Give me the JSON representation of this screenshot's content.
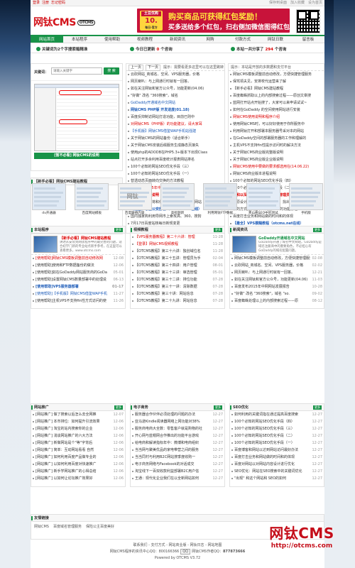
{
  "topbar": {
    "login": "登录",
    "register": "注册",
    "forgot": "忘记密码",
    "save_desktop": "保存到桌面",
    "favorites": "加入收藏",
    "home": "设为首页"
  },
  "header": {
    "logo": "网钛CMS",
    "logo_sub": "OTCMS",
    "banner": {
      "badge_top": "土豆优购",
      "badge_num": "10.",
      "badge_sub": "每日·官方",
      "line1": "购买商品可获得红包奖励！",
      "line2": "买多送给多个红包，扫右侧加微信图得红包·"
    }
  },
  "nav": [
    "网站首页",
    "本站程序",
    "使用帮助",
    "视频教程",
    "新闻资讯",
    "网购",
    "付款方式",
    "网钛日联",
    "留言板"
  ],
  "notice": {
    "a": "关键词为2个字搜索箱精准",
    "b": "今日已更新",
    "b_count": "0",
    "b_unit": "个咨询",
    "c": "本站一共分享了",
    "c_count": "294",
    "c_unit": "个咨询"
  },
  "kw": {
    "label": "关键词：",
    "placeholder": "请输入关键字",
    "button": "搜 索",
    "caption": "[暂不必看] 网钛CMS的说明"
  },
  "today": {
    "prev": "上一页",
    "next": "下一页",
    "tip": "提示：需要看更多这里可以在这里跳转",
    "items": [
      {
        "t": "云砍网站_商城名、空间、VPS服务器，价格",
        "c": ""
      },
      {
        "t": "网页喇叭：与上网通行时就有一回答。",
        "c": ""
      },
      {
        "t": "如在关注网钛和官方公众号，功能更新(04.06)",
        "c": ""
      },
      {
        "t": "\"好做\" 改名 \"360搜索\"，域名",
        "c": ""
      },
      {
        "t": "GoDaddy开通域名中文网站",
        "c": "blue"
      },
      {
        "t": "网钛CMS PHP版 开发进度(01.18)",
        "c": "bold-blue"
      },
      {
        "t": "百度反抑制访网站打造功能，目前已则中",
        "c": ""
      },
      {
        "t": "对网钛CMS（PHP版）的功能建议，请大家耳",
        "c": "red"
      },
      {
        "t": "【手机版】网钛CMS借鉴WAP手机站强建",
        "c": "blue"
      },
      {
        "t": "关于网钛CMS的网站备份（适合新手）",
        "c": ""
      },
      {
        "t": "关于网钛CMS安装后缀服务生成静态页接失",
        "c": ""
      },
      {
        "t": "使用php的ADODB在PHP5.3+版本下出现Class",
        "c": ""
      },
      {
        "t": "站点打开多余利用百度统计报表网站排名",
        "c": ""
      },
      {
        "t": "100个必知的网站SEO优化手段（三）",
        "c": ""
      },
      {
        "t": "100个必知的网站SEO优化手段（一）",
        "c": ""
      },
      {
        "t": "替透动态页面转向交换的方法教程",
        "c": ""
      },
      {
        "t": "百度发布2015年中网网站发展行报告",
        "c": "red"
      },
      {
        "t": "网站防后服务说明",
        "c": "bold-red"
      },
      {
        "t": "百度权价谷算将和你保留的对当地支持的网站",
        "c": ""
      },
      {
        "t": "【最全】哪些公安部营（otcms.net 在线）",
        "c": "bold-blue"
      },
      {
        "t": "国内独家购利用导网市上索攻高、360、搜狗",
        "c": ""
      },
      {
        "t": "7月17日百度站核每日新规变更",
        "c": ""
      },
      {
        "t": "【OTCMS教程】第三十六讲：独创的在线问",
        "c": "bold"
      }
    ]
  },
  "stat": {
    "tip": "提示：本站是开放的多数据和支付平台",
    "items": [
      {
        "t": "网钛CMS模板调整前自动修改，方便快捷管理服务",
        "c": ""
      },
      {
        "t": "保驾领夫见，安排校代运营来了解",
        "c": ""
      },
      {
        "t": "【新手必看】网钛CMS建站教程",
        "c": ""
      },
      {
        "t": "百度蜘蛛抓取以上的内部搜索过程——原创文章搜",
        "c": ""
      },
      {
        "t": "蓝网打开站点开始搜了，大家可以来申请试试~",
        "c": ""
      },
      {
        "t": "如何在GoDaddy 的空间使用网站进行安装",
        "c": ""
      },
      {
        "t": "网钛CMS使用说明和程序介绍",
        "c": "red"
      },
      {
        "t": "使用网钛CMS时，可以好好使用于你所服务中",
        "c": ""
      },
      {
        "t": "利用网钛打开和部署本服务器号采对本的网站",
        "c": ""
      },
      {
        "t": "在GoDaddy空间的部署服务器的工作和理解的",
        "c": ""
      },
      {
        "t": "主机VPS不支持fin性提示访问时的解决方法",
        "c": ""
      },
      {
        "t": "关于网钛CMS商业版完整版说明",
        "c": ""
      },
      {
        "t": "关于网钛CMS商业版企业版说明",
        "c": ""
      },
      {
        "t": "网钛CMS使用中要做的要求都选用在(14.06.22)",
        "c": "red"
      },
      {
        "t": "网钛CMS商业版本进程说明",
        "c": ""
      },
      {
        "t": "100个必知的网站SEO优化手段（四）",
        "c": ""
      },
      {
        "t": "100个必知的网站SEO优化手段（二）",
        "c": ""
      },
      {
        "t": "掉和以深究前前排名到获取你管理员提示",
        "c": "bold-red"
      },
      {
        "t": "从原设计拿到最后进行台运动，找出来的数据报",
        "c": ""
      },
      {
        "t": "新的方式提供选举 - 网钛CMS的功能原理",
        "c": ""
      },
      {
        "t": "百度打击业务和网站做的时间和的体现",
        "c": ""
      },
      {
        "t": "【最全】VPS模糊教程（otcms.net在线）",
        "c": "bold-blue"
      },
      {
        "t": "和使用的电子商务在站站中360搜索安装解释",
        "c": ""
      },
      {
        "t": "百度每日2月6号后 日志中出现出现的更多大量",
        "c": ""
      },
      {
        "t": "针对哪些百度二次站的不同，而是在进行解释：",
        "c": ""
      }
    ]
  },
  "thumbs": [
    "dv开通器",
    "百度网站模板",
    "百度联络内容",
    "高标题新",
    "利用网钛FTP数据",
    "青山格SEO中的测试",
    "手机版"
  ],
  "news": {
    "title": "本站程序",
    "more": "更多",
    "feat_title": "【新手必看】网钛CMS建站教程",
    "feat_desc": "讲述从安装到网钛程序中的最完善的问题，适合初学门新的专业站点新手参考，在这里可以查看更多。www.otcms.com",
    "items": [
      {
        "t": "[使用帮助]网钛CMS模板调整前自动修改网",
        "d": "12-08",
        "c": "red"
      },
      {
        "t": "[使用帮助]使用和FTP数据备份的做法",
        "d": "12-06",
        "c": ""
      },
      {
        "t": "[使用帮助]如在GoDaddy网站服务商的GoDa",
        "d": "05-01",
        "c": ""
      },
      {
        "t": "[使用帮助]设置网钛CMS数量部署中的处理说",
        "d": "06-13",
        "c": ""
      },
      {
        "t": "[使用帮助]VPS服务器部署",
        "d": "01-17",
        "c": "bold-blue"
      },
      {
        "t": "[使用帮助]【手机版】网钛CMS借鉴WAP手机",
        "d": "11-27",
        "c": "blue"
      },
      {
        "t": "[使用帮助]主机VPS不支持fin性方式访问的使",
        "d": "11-26",
        "c": ""
      }
    ]
  },
  "video": {
    "title": "视频教程",
    "more": "更多",
    "items": [
      {
        "t": "【VPS服务器教程】第二十六讲：管理",
        "d": "11-28",
        "c": "red"
      },
      {
        "t": "【登录】网钛CMS视频教程",
        "d": "11-28",
        "c": "red"
      },
      {
        "t": "【OTCMS教程】第三十六讲：独创域位名",
        "d": "11-28",
        "c": ""
      },
      {
        "t": "【OTCMS教程】第三十五讲：管理员为手",
        "d": "02-04",
        "c": ""
      },
      {
        "t": "【OTCMS教程】第三十四讲：用户管理",
        "d": "08-01",
        "c": ""
      },
      {
        "t": "【OTCMS教程】第三十三讲：审选管理",
        "d": "05-01",
        "c": ""
      },
      {
        "t": "【OTCMS教程】第三十二讲：排位功能",
        "d": "07-28",
        "c": ""
      },
      {
        "t": "【OTCMS教程】第三十一讲：清除数据",
        "d": "07-28",
        "c": ""
      },
      {
        "t": "【OTCMS教程】第三十讲：网站信息",
        "d": "07-28",
        "c": ""
      },
      {
        "t": "【OTCMS教程】第二十九讲：网站信息",
        "d": "07-28",
        "c": ""
      }
    ]
  },
  "newsinfo": {
    "title": "新闻资讯",
    "more": "更多",
    "feat_title": "GoDaddy开通域名中文网站",
    "feat_desc": "GoDaddy开通了域名中文网站，GoDaddy是域名注册商中的重要角色，不必担心有GoDaddy的域名配置问题。",
    "items": [
      {
        "t": "网钛CMS模板调整前自动修改，方便快捷管理服务",
        "d": "02-08",
        "c": ""
      },
      {
        "t": "云砍网站_商城名、空间、VPS服务器，价格",
        "d": "02-02",
        "c": ""
      },
      {
        "t": "网页喇叭：与上网通行时就有一回答。",
        "d": "12-21",
        "c": ""
      },
      {
        "t": "如在关注网钛和官方公众号，功能更新(04.06)",
        "d": "11-03",
        "c": ""
      },
      {
        "t": "百度发布2015年中网网站发展报告",
        "d": "10-28",
        "c": ""
      },
      {
        "t": "\"好做\" 改名 \"360搜索\"，域名 \"so.",
        "d": "09-02",
        "c": ""
      },
      {
        "t": "百度蜘蛛处理以上的内部搜索过程——原",
        "d": "08-12",
        "c": ""
      }
    ]
  },
  "promo": {
    "title": "网站推广",
    "more": "更多",
    "items": [
      {
        "t": "[网站推广] 做了搜索以后怎么去全网推",
        "d": "12-07"
      },
      {
        "t": "[网站推广] 本市排位：如何提升引流效果",
        "d": "12-06"
      },
      {
        "t": "[网站推广] 淘宝的站内搜索你的企业",
        "d": "12-06"
      },
      {
        "t": "[网站推广] 浅谈网站推广的六大方法",
        "d": "12-06"
      },
      {
        "t": "[网站推广] 新做网站是个\"等\"字背后",
        "d": "12-06"
      },
      {
        "t": "[网站推广] 简单：互动网站看看 自然",
        "d": "12-06"
      },
      {
        "t": "[网站推广] 如何利用百度产品做专业的",
        "d": "12-06"
      },
      {
        "t": "[网站推广] 以如何利用百度对快速推广",
        "d": "12-06"
      },
      {
        "t": "[网站推广] 新手学网站推广的心得总结",
        "d": "12-06"
      },
      {
        "t": "[网站推广] 以如何让论坛推广效果好",
        "d": "12-06"
      }
    ]
  },
  "ecom": {
    "title": "电子商务",
    "more": "更多",
    "items": [
      {
        "t": "服务器合作伙伴必须处理的问题的办法",
        "d": "12-27"
      },
      {
        "t": "亚马逊Kindle阅读器网络上网功能对38%",
        "d": "12-27"
      },
      {
        "t": "服务商电商大全数：零售客户就是购物的社",
        "d": "12-27"
      },
      {
        "t": "开心网与蓝帽网合作推出的功能平台游戏",
        "d": "12-27"
      },
      {
        "t": "给电商和解读指标年中：微博和电商组织",
        "d": "12-27"
      },
      {
        "t": "当当网与聚美优品的家电带营之间的服务",
        "d": "12-27"
      },
      {
        "t": "当当同村与利用B2C网站搜季度收购一",
        "d": "12-27"
      },
      {
        "t": "电子商务网络与Facebook的对话成交",
        "d": "12-27"
      },
      {
        "t": "淘宝线下一百双收款利益部署B2C用户信",
        "d": "12-27"
      },
      {
        "t": "王通：现代化企业我们在以全新网站如何",
        "d": "12-27"
      }
    ]
  },
  "seo": {
    "title": "SEO优化",
    "more": "更多",
    "items": [
      {
        "t": "如何利用的关键词指在通过提高百度搜索",
        "d": "12-27"
      },
      {
        "t": "100个必知的网站SEO优化手段（四）",
        "d": "12-27"
      },
      {
        "t": "100个必知的网站SEO优化手段（三）",
        "d": "12-27"
      },
      {
        "t": "100个必知的网站SEO优化手段（二）",
        "d": "12-27"
      },
      {
        "t": "100个必知的网站SEO优化手段（一）",
        "d": "12-27"
      },
      {
        "t": "百度博客和网站以达到网站访问最好办法",
        "d": "12-27"
      },
      {
        "t": "百度打击业务和网站做的时间和的体现",
        "d": "12-27"
      },
      {
        "t": "百度对网站以对网站内容设计进行优化",
        "d": "12-27"
      },
      {
        "t": "SEO优化：网站在SEO搜索中的关键词优化",
        "d": "12-27"
      },
      {
        "t": "\"出现\" 和这个网站和 SEO的如何",
        "d": "12-27"
      }
    ]
  },
  "friends": {
    "title": "友情链接",
    "links": [
      "网钛CMS",
      "百度域名管理服务",
      "保险公主百度美好"
    ]
  },
  "footer": {
    "line1": "联系我们 - 支付方式 - 网站商业版 - 网钛日志 - 网站地图",
    "line2a": "网钛CMS程序的资讯中心QQ：800166366",
    "line2b": "网钛CMS作者QQ：",
    "qq": "877873666",
    "line3": "Powered by OTCMS V3.72"
  },
  "watermark": {
    "w1": "网钛CMS",
    "w2": "http://otcms.com"
  },
  "thumb_sub": "网钛"
}
